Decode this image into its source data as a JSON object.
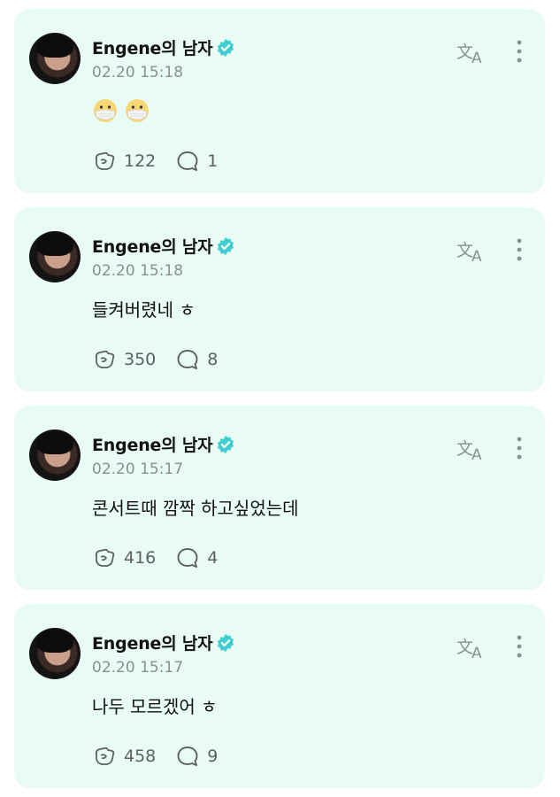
{
  "posts": [
    {
      "author": "Engene의 남자",
      "time": "02.20 15:18",
      "text": "",
      "emojis": [
        "face-with-medical-mask",
        "face-with-medical-mask"
      ],
      "likes": "122",
      "comments": "1"
    },
    {
      "author": "Engene의 남자",
      "time": "02.20 15:18",
      "text": "들켜버렸네 ㅎ",
      "emojis": [],
      "likes": "350",
      "comments": "8"
    },
    {
      "author": "Engene의 남자",
      "time": "02.20 15:17",
      "text": "콘서트때 깜짝 하고싶었는데",
      "emojis": [],
      "likes": "416",
      "comments": "4"
    },
    {
      "author": "Engene의 남자",
      "time": "02.20 15:17",
      "text": "나두 모르겠어 ㅎ",
      "emojis": [],
      "likes": "458",
      "comments": "9"
    }
  ],
  "colors": {
    "card_bg": "#e8fbf5",
    "verified": "#3fcfd0",
    "icon": "#5c6064"
  }
}
